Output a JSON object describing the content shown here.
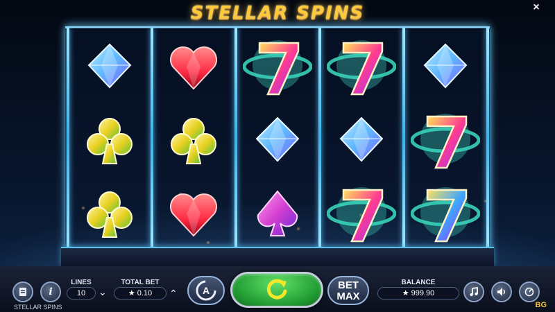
{
  "title": "STELLAR SPINS",
  "close_label": "×",
  "reels": [
    [
      "diamond",
      "club",
      "club"
    ],
    [
      "heart",
      "club",
      "heart"
    ],
    [
      "seven",
      "diamond",
      "spade"
    ],
    [
      "seven",
      "diamond",
      "seven"
    ],
    [
      "diamond",
      "seven",
      "seven"
    ]
  ],
  "symbol_colors": {
    "diamond": "#5fb6ff",
    "heart": "#ff2b44",
    "club": "#e8d020",
    "spade": "#d43fd0",
    "seven": "#ff3d8f",
    "seven_alt": "#3fa6ff",
    "ring": "#39d1b8"
  },
  "controls": {
    "lines_label": "LINES",
    "lines_value": "10",
    "total_bet_label": "TOTAL BET",
    "total_bet_value": "★ 0.10",
    "bet_max_label_1": "BET",
    "bet_max_label_2": "MAX",
    "balance_label": "BALANCE",
    "balance_value": "★ 999.90",
    "info_label": "i",
    "game_name": "STELLAR SPINS",
    "brand_tag": "BG"
  },
  "icons": {
    "paytable": "paytable-icon",
    "info": "info-icon",
    "autoplay": "autoplay-icon",
    "spin": "spin-arrow-icon",
    "music": "music-note-icon",
    "sound": "speaker-icon",
    "speed": "turbo-icon"
  }
}
